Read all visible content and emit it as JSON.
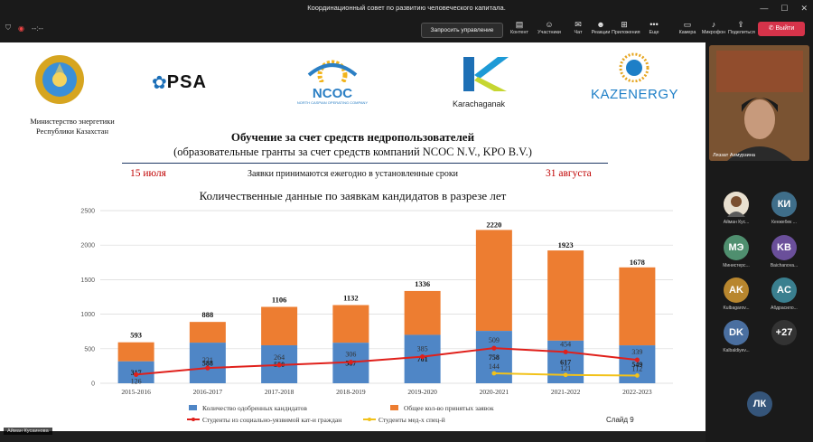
{
  "window": {
    "title": "Координационный совет по развитию человеческого капитала."
  },
  "toolbar": {
    "time": "--:--",
    "remote_control": "Запросить управление",
    "tools": [
      {
        "icon": "content-icon",
        "label": "Контент"
      },
      {
        "icon": "people-icon",
        "label": "Участники"
      },
      {
        "icon": "chat-icon",
        "label": "Чат"
      },
      {
        "icon": "reactions-icon",
        "label": "Реакции"
      },
      {
        "icon": "apps-icon",
        "label": "Приложения"
      },
      {
        "icon": "more-icon",
        "label": "Еще"
      },
      {
        "icon": "camera-icon",
        "label": "Камера"
      },
      {
        "icon": "microphone-icon",
        "label": "Микрофон"
      },
      {
        "icon": "share-icon",
        "label": "Поделиться"
      }
    ],
    "exit": "Выйти"
  },
  "slide": {
    "ministry": "Министерство энергетики Республики Казахстан",
    "logos": {
      "psa": "PSA",
      "ncoc": "NCOC",
      "ncoc_sub": "NORTH CASPIAN OPERATING COMPANY",
      "karachaganak": "Karachaganak",
      "kazenergy": "KAZENERGY"
    },
    "title": "Обучение за счет средств недропользователей",
    "subtitle": "(образовательные гранты за счет средств компаний NCOC N.V., KPO B.V.)",
    "date_start": "15 июля",
    "date_end": "31 августа",
    "note": "Заявки принимаются ежегодно в установленные сроки",
    "slide_number": "Слайд 9",
    "colors": {
      "approved": "#4f86c6",
      "other": "#ed7d31",
      "socially": "#e0201b",
      "medical": "#f2c21a"
    }
  },
  "chart_data": {
    "type": "bar",
    "title": "Количественные данные по заявкам кандидатов в разрезе лет",
    "categories": [
      "2015-2016",
      "2016-2017",
      "2017-2018",
      "2018-2019",
      "2019-2020",
      "2020-2021",
      "2021-2022",
      "2022-2023"
    ],
    "ylim": [
      0,
      2500
    ],
    "yticks": [
      0,
      500,
      1000,
      1500,
      2000,
      2500
    ],
    "grid": true,
    "legend": "bottom",
    "totals": [
      593,
      888,
      1106,
      1132,
      1336,
      2220,
      1923,
      1678
    ],
    "series": [
      {
        "name": "Количество одобренных кандидатов",
        "type": "bar",
        "values": [
          317,
          588,
          550,
          587,
          701,
          758,
          617,
          549
        ]
      },
      {
        "name": "Общее кол-во принятых заявок",
        "type": "bar",
        "values": [
          593,
          888,
          1106,
          1132,
          1336,
          2220,
          1923,
          1678
        ]
      },
      {
        "name": "Студенты из социально-уязвимой кат-и граждан",
        "type": "line",
        "values": [
          126,
          221,
          264,
          306,
          385,
          509,
          454,
          339
        ]
      },
      {
        "name": "Студенты мед-х спец-й",
        "type": "line",
        "values": [
          null,
          null,
          null,
          null,
          null,
          144,
          121,
          112
        ]
      }
    ]
  },
  "participants": {
    "main": "Ляззат Ахмурзина",
    "tiles": [
      {
        "initials": "",
        "name": "Айман Кус...",
        "color": "#8a6a4a",
        "photo": true
      },
      {
        "initials": "КИ",
        "name": "Кенжебек ...",
        "color": "#3f6e8a"
      },
      {
        "initials": "МЭ",
        "name": "Министерс...",
        "color": "#4f8f6f"
      },
      {
        "initials": "KB",
        "name": "Baichanova...",
        "color": "#6a4f9a"
      },
      {
        "initials": "AK",
        "name": "Kulbagarov...",
        "color": "#b8862e"
      },
      {
        "initials": "AC",
        "name": "Абдрасило...",
        "color": "#3a7f8f"
      },
      {
        "initials": "DK",
        "name": "Kalbaldiyev...",
        "color": "#4a6fa0"
      },
      {
        "initials": "+27",
        "name": "",
        "color": "#333"
      },
      {
        "initials": "ЛК",
        "name": "",
        "color": "#35557a"
      }
    ],
    "self_name": "Айман Кусаинова"
  }
}
